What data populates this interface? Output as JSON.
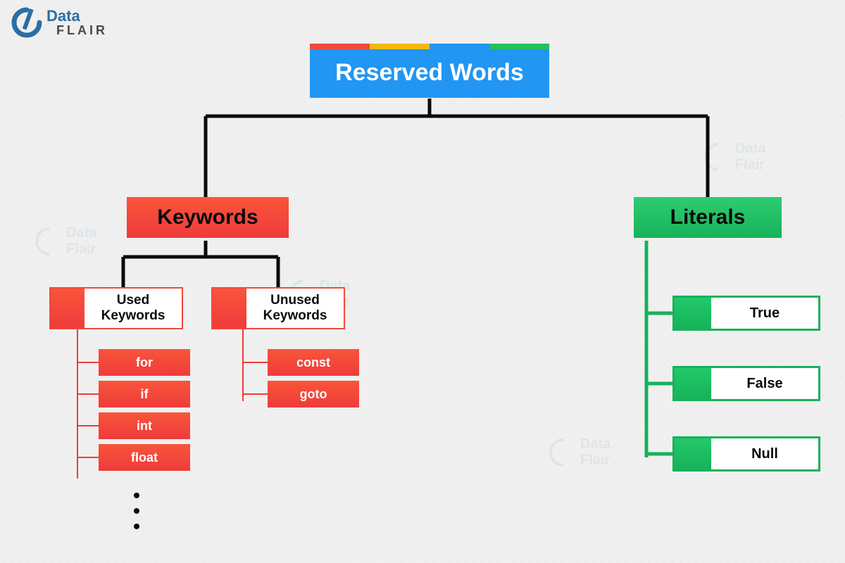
{
  "logo": {
    "brand_top": "Data",
    "brand_bottom": "FLAIR"
  },
  "root": {
    "title": "Reserved Words",
    "stripe_colors": [
      "#ef4a3f",
      "#f5b90b",
      "#2196f3",
      "#22c15e"
    ]
  },
  "keywords": {
    "label": "Keywords",
    "used": {
      "label": "Used Keywords",
      "items": [
        "for",
        "if",
        "int",
        "float"
      ]
    },
    "unused": {
      "label": "Unused Keywords",
      "items": [
        "const",
        "goto"
      ]
    }
  },
  "literals": {
    "label": "Literals",
    "items": [
      "True",
      "False",
      "Null"
    ]
  }
}
